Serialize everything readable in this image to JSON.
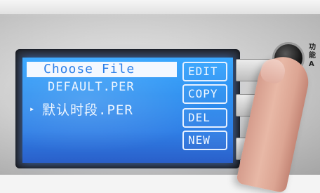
{
  "screen": {
    "title": "Choose File",
    "files": [
      {
        "name": "DEFAULT.PER",
        "selected": false
      },
      {
        "name": "默认时段.PER",
        "selected": true
      }
    ],
    "cursor": "▸"
  },
  "softkeys": {
    "edit": "EDIT",
    "copy": "COPY",
    "del": "DEL",
    "new": "NEW"
  },
  "device": {
    "knob_label": "功能A",
    "side_buttons": [
      "",
      "",
      ""
    ]
  },
  "colors": {
    "lcd_background": "#2b8ff0",
    "title_highlight": "#f4f8ff",
    "text": "#eef6ff"
  }
}
